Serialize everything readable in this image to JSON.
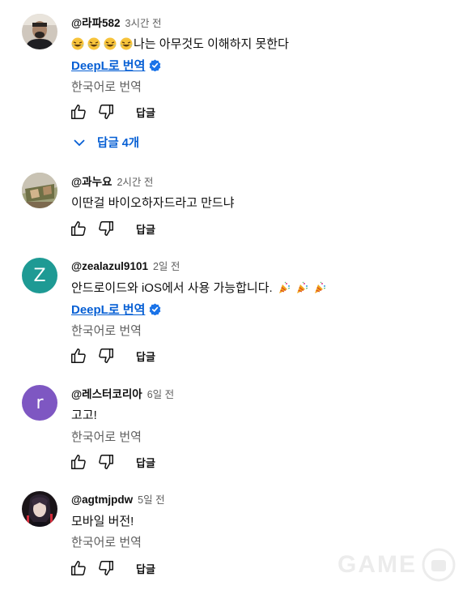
{
  "comments": [
    {
      "author": "@라파582",
      "time": "3시간 전",
      "text": "나는 아무것도 이해하지 못한다",
      "emoji_count": 4,
      "deepl": "DeepL로 번역",
      "translate": "한국어로 번역",
      "reply": "답글",
      "replies": "답글 4개"
    },
    {
      "author": "@과누요",
      "time": "2시간 전",
      "text": "이딴걸 바이오하자드라고 만드냐",
      "reply": "답글"
    },
    {
      "author": "@zealazul9101",
      "time": "2일 전",
      "text": "안드로이드와 iOS에서 사용 가능합니다.",
      "avatar_letter": "Z",
      "avatar_color": "#1e9a94",
      "deepl": "DeepL로 번역",
      "translate": "한국어로 번역",
      "reply": "답글"
    },
    {
      "author": "@레스터코리아",
      "time": "6일 전",
      "text": "고고!",
      "avatar_letter": "r",
      "avatar_color": "#7e57c2",
      "translate": "한국어로 번역",
      "reply": "답글"
    },
    {
      "author": "@agtmjpdw",
      "time": "5일 전",
      "text": "모바일 버전!",
      "translate": "한국어로 번역",
      "reply": "답글"
    }
  ],
  "icons": {
    "like": "thumbs-up-icon",
    "dislike": "thumbs-down-icon",
    "verified": "deepl-verified-icon",
    "expand": "chevron-down-icon",
    "emoji_laugh": "laughing-emoji-icon",
    "emoji_party": "party-popper-icon"
  },
  "colors": {
    "link": "#065fd4",
    "secondary_text": "#606060"
  },
  "watermark": {
    "text": "GAME"
  }
}
